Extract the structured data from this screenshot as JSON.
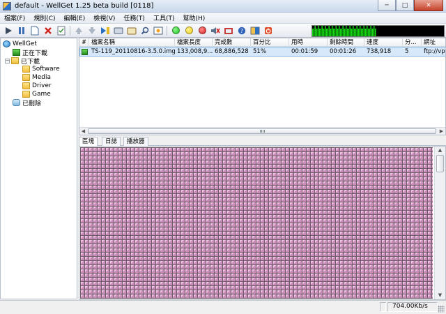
{
  "window": {
    "title": "default - WellGet 1.25 beta  build [0118]",
    "minimize": "─",
    "maximize": "□",
    "close": "✕"
  },
  "menu": [
    "檔案(F)",
    "規則(C)",
    "編輯(E)",
    "檢視(V)",
    "任務(T)",
    "工具(T)",
    "幫助(H)"
  ],
  "toolbar": {
    "icons": [
      "play-icon",
      "pause-icon",
      "new-file-icon",
      "delete-icon",
      "properties-icon",
      "move-up-icon",
      "move-down-icon",
      "schedule-icon",
      "monitor-icon",
      "options-icon",
      "search-icon",
      "log-icon",
      "green-light-icon",
      "yellow-light-icon",
      "red-light-icon",
      "mute-icon",
      "settings-icon",
      "help-icon",
      "about-icon",
      "exit-icon"
    ],
    "colors": {
      "green": "#19c419",
      "yellow": "#f2d21a",
      "red": "#d61f1f"
    }
  },
  "tree": {
    "root": "WellGet",
    "downloading": "正在下載",
    "downloaded": "已下載",
    "folders": [
      "Software",
      "Media",
      "Driver",
      "Game"
    ],
    "deleted": "已刪除"
  },
  "list": {
    "columns": [
      "#",
      "檔案名稱",
      "檔案長度",
      "完成數",
      "百分比",
      "用時",
      "剩餘時間",
      "速度",
      "分...",
      "網址"
    ],
    "rows": [
      {
        "num": "",
        "name": "TS-119_20110816-3.5.0.img",
        "size": "133,008,9...",
        "done": "68,886,528",
        "percent": "51%",
        "elapsed": "00:01:59",
        "remaining": "00:01:26",
        "speed": "738,918",
        "parts": "5",
        "url": "ftp://vp"
      }
    ]
  },
  "tabs": [
    "區塊",
    "日誌",
    "播放器"
  ],
  "blockmap": {
    "progress": 0.51,
    "block_color": "#d6a3c8"
  },
  "status": {
    "speed": "704.00Kb/s"
  }
}
